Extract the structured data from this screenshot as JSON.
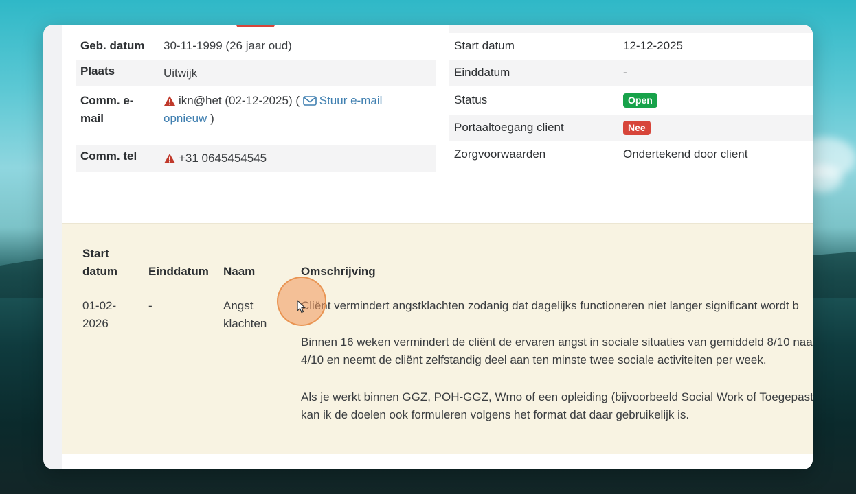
{
  "client_info": {
    "rows": [
      {
        "label": "Geb. datum",
        "value": "30-11-1999 (26 jaar oud)"
      },
      {
        "label": "Plaats",
        "value": "Uitwijk"
      },
      {
        "label": "Comm. e-mail",
        "label_line1": "Comm. e-",
        "label_line2": "mail",
        "email": "ikn@het (02-12-2025) (",
        "resend_line1": "Stuur e-mail",
        "resend_line2": "opnieuw",
        "close_paren": ")"
      },
      {
        "label": "Comm. tel",
        "value": "+31 0645454545"
      }
    ]
  },
  "trajectory_info": {
    "rows": [
      {
        "label": "Start datum",
        "value": "12-12-2025"
      },
      {
        "label": "Einddatum",
        "value": "-"
      },
      {
        "label": "Status",
        "badge": "Open"
      },
      {
        "label": "Portaaltoegang client",
        "badge": "Nee"
      },
      {
        "label": "Zorgvoorwaarden",
        "value": "Ondertekend door client"
      }
    ]
  },
  "goals": {
    "headers": {
      "start_line1": "Start",
      "start_line2": "datum",
      "end": "Einddatum",
      "name": "Naam",
      "description": "Omschrijving"
    },
    "row": {
      "start_line1": "01-02-",
      "start_line2": "2026",
      "end": "-",
      "name_line1": "Angst",
      "name_line2": "klachten",
      "desc_p1": "Cliënt vermindert angstklachten zodanig dat dagelijks functioneren niet langer significant wordt b",
      "desc_p2_l1": "Binnen 16 weken vermindert de cliënt de ervaren angst in sociale situaties van gemiddeld 8/10 naa",
      "desc_p2_l2": "4/10 en neemt de cliënt zelfstandig deel aan ten minste twee sociale activiteiten per week.",
      "desc_p3_l1": "Als je werkt binnen GGZ, POH-GGZ, Wmo of een opleiding (bijvoorbeeld Social Work of Toegepast",
      "desc_p3_l2": "kan ik de doelen ook formuleren volgens het format dat daar gebruikelijk is."
    }
  },
  "colors": {
    "open_badge": "#17a24a",
    "nee_badge": "#d7453a",
    "link": "#3f7fb0",
    "goals_background": "#f8f3e2",
    "warning_icon": "#c0392b"
  }
}
